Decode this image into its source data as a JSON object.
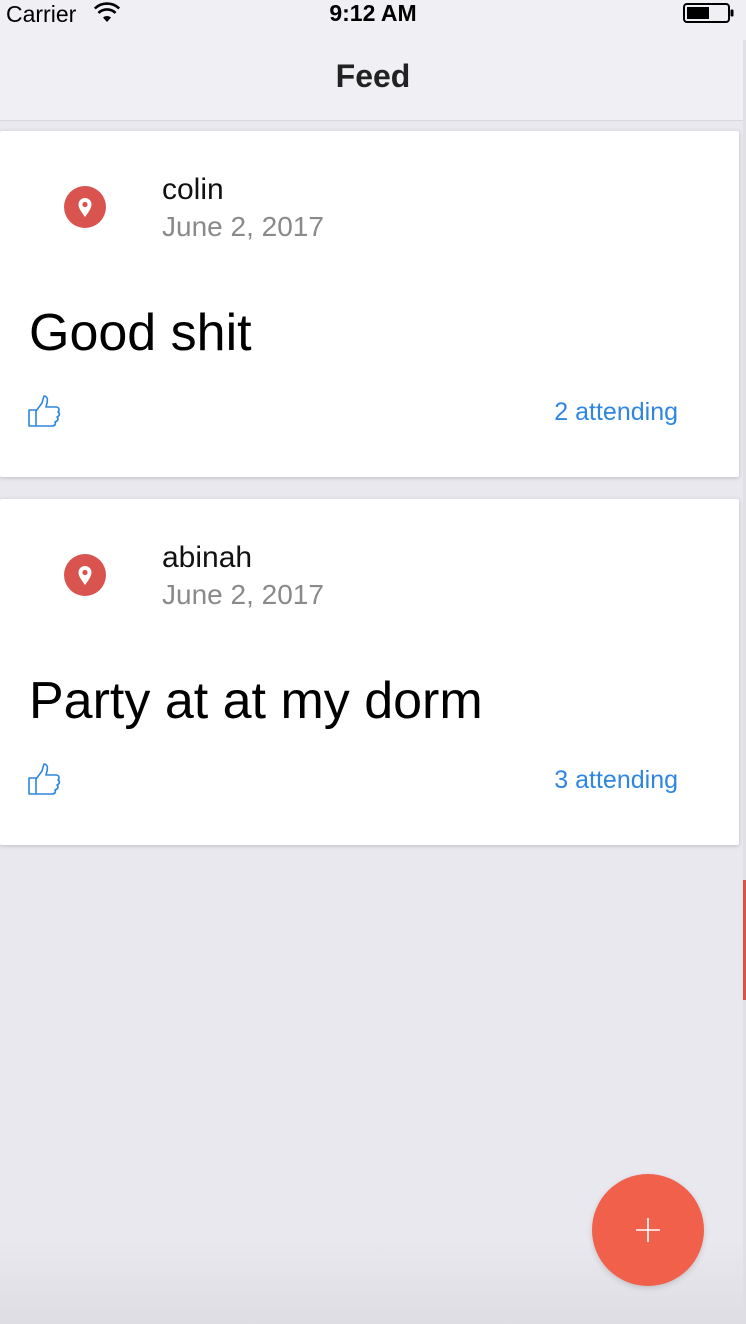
{
  "status_bar": {
    "carrier": "Carrier",
    "time": "9:12 AM",
    "icons": [
      "wifi-icon",
      "battery-icon"
    ]
  },
  "nav": {
    "title": "Feed"
  },
  "posts": [
    {
      "author": "colin",
      "date": "June 2, 2017",
      "text": "Good shit",
      "attending": "2 attending",
      "icon": "location-pin-icon"
    },
    {
      "author": "abinah",
      "date": "June 2, 2017",
      "text": "Party at at my dorm",
      "attending": "3 attending",
      "icon": "location-pin-icon"
    }
  ],
  "fab": {
    "icon": "plus-icon"
  },
  "colors": {
    "accent_blue": "#2f86e0",
    "pin_red": "#d9534f",
    "fab_orange": "#f0604a",
    "background": "#e9e8ee"
  }
}
